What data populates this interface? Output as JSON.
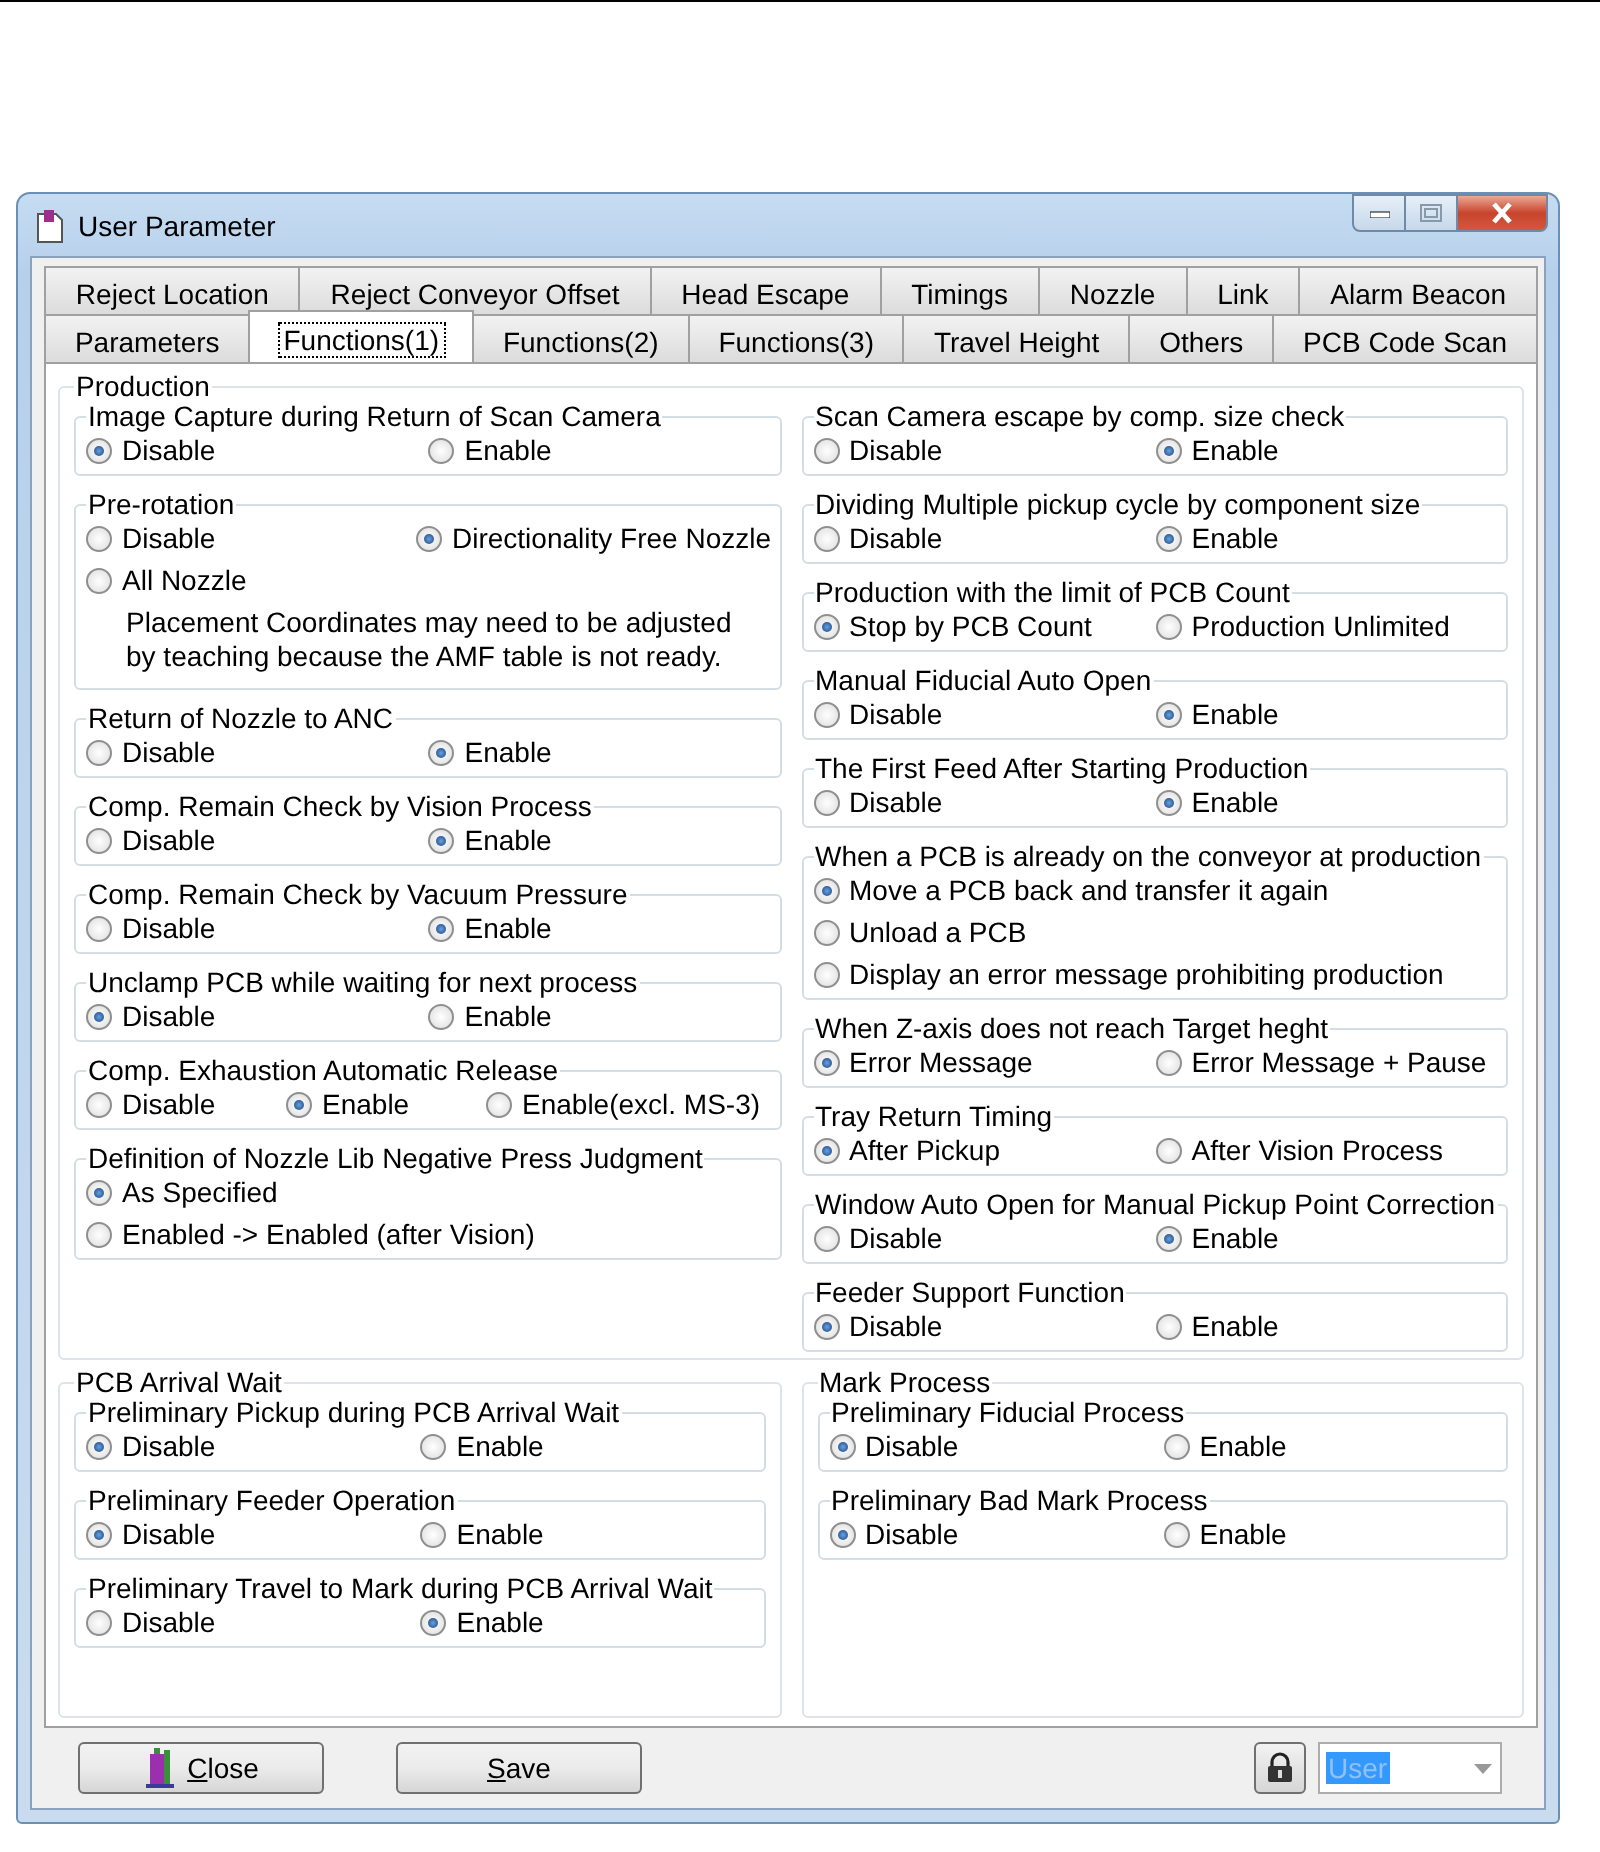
{
  "window": {
    "title": "User Parameter"
  },
  "tab_rows": [
    [
      {
        "label": "Reject Location",
        "selected": false
      },
      {
        "label": "Reject Conveyor Offset",
        "selected": false
      },
      {
        "label": "Head Escape",
        "selected": false
      },
      {
        "label": "Timings",
        "selected": false
      },
      {
        "label": "Nozzle",
        "selected": false
      },
      {
        "label": "Link",
        "selected": false
      },
      {
        "label": "Alarm Beacon",
        "selected": false
      }
    ],
    [
      {
        "label": "Parameters",
        "selected": false
      },
      {
        "label": "Functions(1)",
        "selected": true
      },
      {
        "label": "Functions(2)",
        "selected": false
      },
      {
        "label": "Functions(3)",
        "selected": false
      },
      {
        "label": "Travel Height",
        "selected": false
      },
      {
        "label": "Others",
        "selected": false
      },
      {
        "label": "PCB Code Scan",
        "selected": false
      }
    ]
  ],
  "sections": [
    {
      "title": "Production",
      "columns": [
        [
          {
            "title": "Image Capture during Return of Scan Camera",
            "rows": [
              [
                {
                  "label": "Disable",
                  "selected": true
                },
                {
                  "label": "Enable",
                  "selected": false
                }
              ]
            ]
          },
          {
            "title": "Pre-rotation",
            "rows": [
              [
                {
                  "label": "Disable",
                  "selected": false
                },
                {
                  "label": "Directionality Free Nozzle",
                  "selected": true
                }
              ],
              [
                {
                  "label": "All Nozzle",
                  "selected": false
                }
              ]
            ],
            "note_lines": [
              "Placement Coordinates may need to be adjusted",
              "by teaching because the AMF table is not ready."
            ]
          },
          {
            "title": "Return of Nozzle to ANC",
            "rows": [
              [
                {
                  "label": "Disable",
                  "selected": false
                },
                {
                  "label": "Enable",
                  "selected": true
                }
              ]
            ]
          },
          {
            "title": "Comp. Remain Check by Vision Process",
            "rows": [
              [
                {
                  "label": "Disable",
                  "selected": false
                },
                {
                  "label": "Enable",
                  "selected": true
                }
              ]
            ]
          },
          {
            "title": "Comp. Remain Check by Vacuum Pressure",
            "rows": [
              [
                {
                  "label": "Disable",
                  "selected": false
                },
                {
                  "label": "Enable",
                  "selected": true
                }
              ]
            ]
          },
          {
            "title": "Unclamp PCB while waiting for next process",
            "rows": [
              [
                {
                  "label": "Disable",
                  "selected": true
                },
                {
                  "label": "Enable",
                  "selected": false
                }
              ]
            ]
          },
          {
            "title": "Comp. Exhaustion Automatic Release",
            "rows": [
              [
                {
                  "label": "Disable",
                  "selected": false
                },
                {
                  "label": "Enable",
                  "selected": true
                },
                {
                  "label": "Enable(excl. MS-3)",
                  "selected": false
                }
              ]
            ]
          },
          {
            "title": "Definition of Nozzle Lib Negative Press Judgment",
            "rows": [
              [
                {
                  "label": "As Specified",
                  "selected": true
                }
              ],
              [
                {
                  "label": "Enabled -> Enabled (after Vision)",
                  "selected": false
                }
              ]
            ]
          }
        ],
        [
          {
            "title": "Scan Camera escape by comp. size check",
            "rows": [
              [
                {
                  "label": "Disable",
                  "selected": false
                },
                {
                  "label": "Enable",
                  "selected": true
                }
              ]
            ]
          },
          {
            "title": "Dividing Multiple pickup cycle by component size",
            "rows": [
              [
                {
                  "label": "Disable",
                  "selected": false
                },
                {
                  "label": "Enable",
                  "selected": true
                }
              ]
            ]
          },
          {
            "title": "Production with the limit of PCB Count",
            "rows": [
              [
                {
                  "label": "Stop by PCB Count",
                  "selected": true
                },
                {
                  "label": "Production Unlimited",
                  "selected": false
                }
              ]
            ]
          },
          {
            "title": "Manual Fiducial Auto Open",
            "rows": [
              [
                {
                  "label": "Disable",
                  "selected": false
                },
                {
                  "label": "Enable",
                  "selected": true
                }
              ]
            ]
          },
          {
            "title": "The First Feed After Starting Production",
            "rows": [
              [
                {
                  "label": "Disable",
                  "selected": false
                },
                {
                  "label": "Enable",
                  "selected": true
                }
              ]
            ]
          },
          {
            "title": "When a PCB is already on the conveyor at production",
            "rows": [
              [
                {
                  "label": "Move a PCB back and transfer it again",
                  "selected": true
                }
              ],
              [
                {
                  "label": "Unload a PCB",
                  "selected": false
                }
              ],
              [
                {
                  "label": "Display an error message prohibiting production",
                  "selected": false
                }
              ]
            ]
          },
          {
            "title": "When Z-axis does not reach Target heght",
            "rows": [
              [
                {
                  "label": "Error Message",
                  "selected": true
                },
                {
                  "label": "Error Message + Pause",
                  "selected": false
                }
              ]
            ]
          },
          {
            "title": "Tray Return Timing",
            "rows": [
              [
                {
                  "label": "After Pickup",
                  "selected": true
                },
                {
                  "label": "After Vision Process",
                  "selected": false
                }
              ]
            ]
          },
          {
            "title": "Window Auto Open for Manual Pickup Point Correction",
            "rows": [
              [
                {
                  "label": "Disable",
                  "selected": false
                },
                {
                  "label": "Enable",
                  "selected": true
                }
              ]
            ]
          },
          {
            "title": "Feeder Support Function",
            "rows": [
              [
                {
                  "label": "Disable",
                  "selected": true
                },
                {
                  "label": "Enable",
                  "selected": false
                }
              ]
            ]
          }
        ]
      ]
    },
    {
      "title": "PCB Arrival Wait",
      "columns": [
        [
          {
            "title": "Preliminary Pickup during PCB Arrival Wait",
            "rows": [
              [
                {
                  "label": "Disable",
                  "selected": true
                },
                {
                  "label": "Enable",
                  "selected": false
                }
              ]
            ]
          },
          {
            "title": "Preliminary Feeder Operation",
            "rows": [
              [
                {
                  "label": "Disable",
                  "selected": true
                },
                {
                  "label": "Enable",
                  "selected": false
                }
              ]
            ]
          },
          {
            "title": "Preliminary Travel to Mark during PCB Arrival Wait",
            "rows": [
              [
                {
                  "label": "Disable",
                  "selected": false
                },
                {
                  "label": "Enable",
                  "selected": true
                }
              ]
            ]
          }
        ]
      ]
    },
    {
      "title": "Mark Process",
      "columns": [
        [
          {
            "title": "Preliminary Fiducial Process",
            "rows": [
              [
                {
                  "label": "Disable",
                  "selected": true
                },
                {
                  "label": "Enable",
                  "selected": false
                }
              ]
            ]
          },
          {
            "title": "Preliminary Bad Mark Process",
            "rows": [
              [
                {
                  "label": "Disable",
                  "selected": true
                },
                {
                  "label": "Enable",
                  "selected": false
                }
              ]
            ]
          }
        ]
      ]
    }
  ],
  "footer": {
    "buttons": [
      {
        "label": "Close",
        "kind": "close"
      },
      {
        "label": "Save",
        "kind": "save"
      }
    ],
    "user_combo": {
      "value": "User",
      "text_selected": true
    }
  }
}
